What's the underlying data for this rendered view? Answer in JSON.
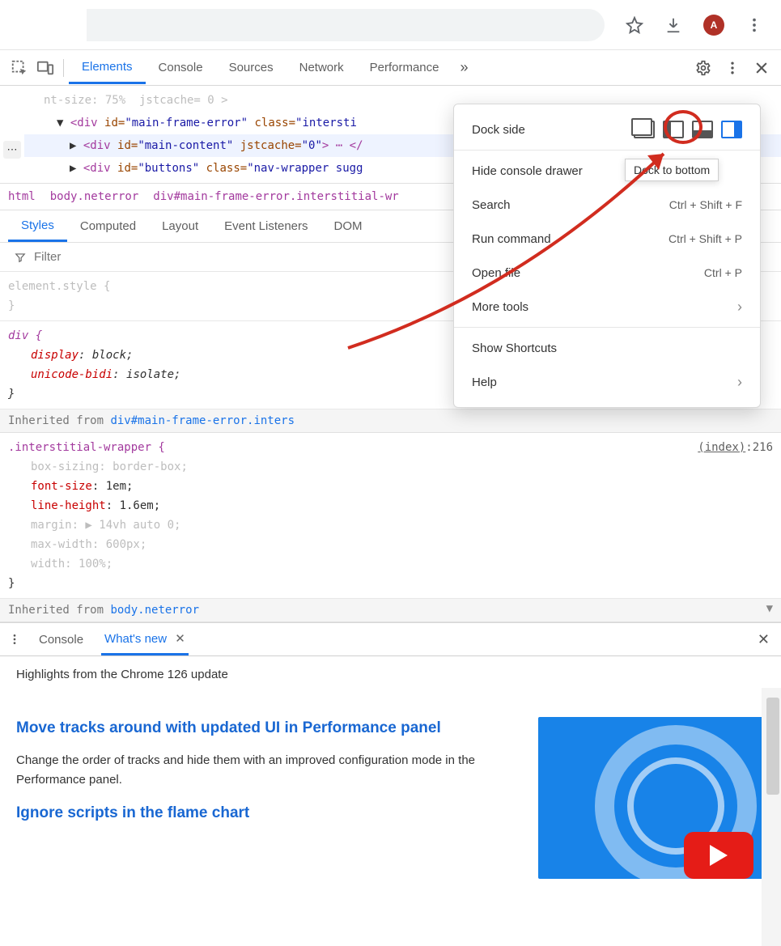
{
  "toolbar": {
    "avatar_letter": "A"
  },
  "devtabs": {
    "elements": "Elements",
    "console": "Console",
    "sources": "Sources",
    "network": "Network",
    "performance": "Performance",
    "more": "»"
  },
  "dom": {
    "l0": "nt-size: 75%  jstcache= 0 >",
    "l1_open": "▼ ",
    "l1_tag": "<div ",
    "l1_a1": "id=",
    "l1_v1": "\"main-frame-error\"",
    "l1_a2": " class=",
    "l1_v2": "\"intersti",
    "l2_open": "▶ ",
    "l2_tag": "<div ",
    "l2_a1": "id=",
    "l2_v1": "\"main-content\"",
    "l2_a2": " jstcache=",
    "l2_v2": "\"0\"",
    "l2_tail": "> ⋯ </",
    "l3_open": "▶ ",
    "l3_tag": "<div ",
    "l3_a1": "id=",
    "l3_v1": "\"buttons\"",
    "l3_a2": " class=",
    "l3_v2": "\"nav-wrapper sugg"
  },
  "breadcrumb": {
    "html": "html",
    "body": "body.neterror",
    "sel": "div#main-frame-error.interstitial-wr"
  },
  "styles_tabs": {
    "styles": "Styles",
    "computed": "Computed",
    "layout": "Layout",
    "el": "Event Listeners",
    "dom": "DOM"
  },
  "filter_placeholder": "Filter",
  "styles": {
    "elstyle": "element.style {",
    "div_sel": "div {",
    "display_k": "display",
    "display_v": ": block;",
    "ub_k": "unicode-bidi",
    "ub_v": ": isolate;",
    "close": "}",
    "inh1_a": "Inherited from ",
    "inh1_b": "div#main-frame-error.inters",
    "iw_sel": ".interstitial-wrapper {",
    "iw_src_a": "(index)",
    "iw_src_b": ":216",
    "bs_k": "box-sizing",
    "bs_v": ": border-box;",
    "fs_k": "font-size",
    "fs_v": ": 1em;",
    "lh_k": "line-height",
    "lh_v": ": 1.6em;",
    "mg_k": "margin",
    "mg_v": ": ▶ 14vh auto 0;",
    "mw_k": "max-width",
    "mw_v": ": 600px;",
    "w_k": "width",
    "w_v": ": 100%;",
    "inh2_a": "Inherited from ",
    "inh2_b": "body.neterror"
  },
  "drawer": {
    "console": "Console",
    "whatsnew": "What's new"
  },
  "wn": {
    "highlights": "Highlights from the Chrome 126 update",
    "title": "Move tracks around with updated UI in Performance panel",
    "body": "Change the order of tracks and hide them with an improved configuration mode in the Performance panel.",
    "sub": "Ignore scripts in the flame chart"
  },
  "dd": {
    "dock": "Dock side",
    "hide": "Hide console drawer",
    "search": "Search",
    "search_k": "Ctrl + Shift + F",
    "run": "Run command",
    "run_k": "Ctrl + Shift + P",
    "open": "Open file",
    "open_k": "Ctrl + P",
    "more": "More tools",
    "shortcuts": "Show Shortcuts",
    "help": "Help"
  },
  "tooltip": "Dock to bottom"
}
